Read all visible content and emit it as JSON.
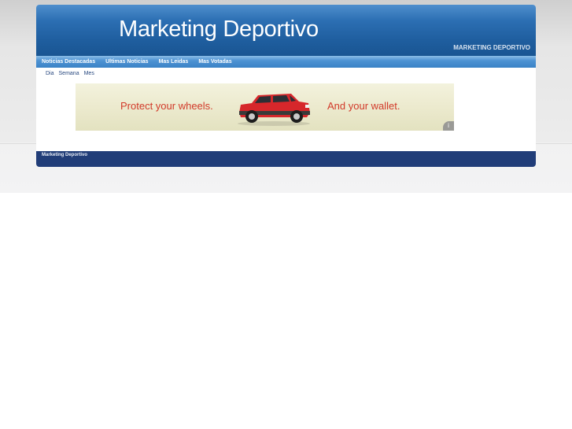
{
  "header": {
    "title": "Marketing Deportivo",
    "tagline": "MARKETING DEPORTIVO"
  },
  "nav": {
    "items": [
      {
        "label": "Noticias Destacadas"
      },
      {
        "label": "Ultimas Noticias"
      },
      {
        "label": "Mas Leidas"
      },
      {
        "label": "Mas Votadas"
      }
    ]
  },
  "tabs": [
    {
      "label": "Dia"
    },
    {
      "label": "Semana"
    },
    {
      "label": "Mes"
    }
  ],
  "ad": {
    "text_left": "Protect your wheels.",
    "text_right": "And your wallet.",
    "info_icon": "info-icon",
    "car_color": "#d6272b"
  },
  "footer": {
    "text": "Marketing Deportivo"
  },
  "colors": {
    "header_blue": "#1f5e9f",
    "nav_blue": "#3a82c6",
    "footer_navy": "#213d78",
    "ad_red": "#d23a2a"
  }
}
